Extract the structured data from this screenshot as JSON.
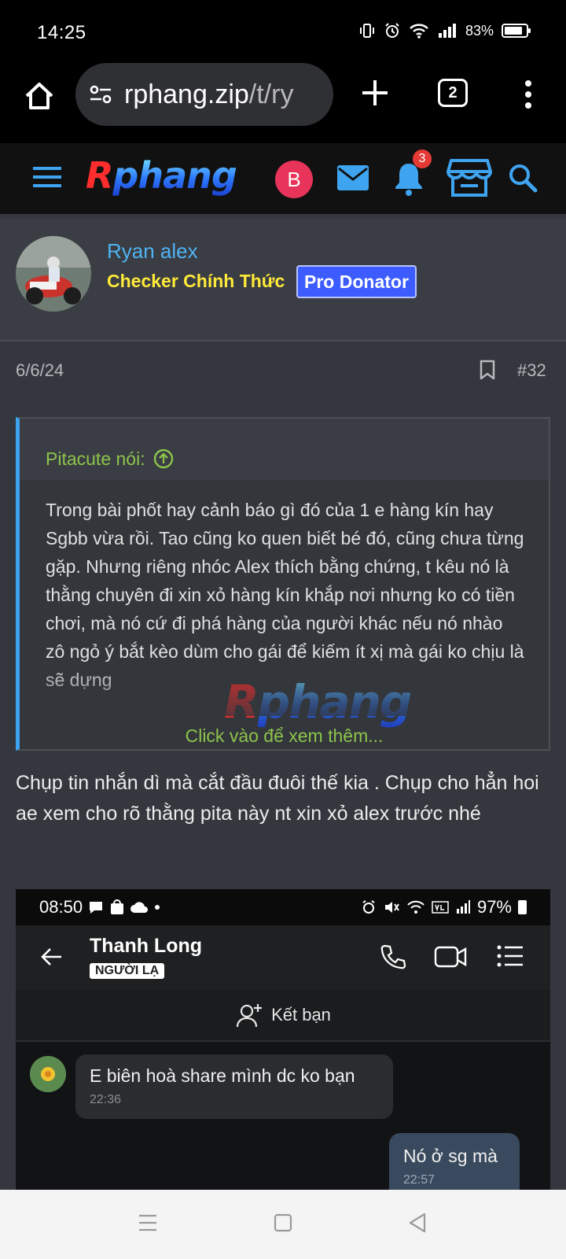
{
  "status_bar": {
    "time": "14:25",
    "battery": "83%"
  },
  "browser": {
    "url_host": "rphang.zip",
    "url_path": "/t/ry",
    "tab_count": "2"
  },
  "site_header": {
    "logo_r": "R",
    "logo_rest": "phang",
    "avatar_letter": "B",
    "notification_count": "3"
  },
  "post": {
    "author": "Ryan alex",
    "author_title": "Checker Chính Thức",
    "badge": "Pro Donator",
    "date": "6/6/24",
    "number": "#32",
    "quote": {
      "author_line": "Pitacute nói:",
      "text": "Trong bài phốt hay cảnh báo gì đó của 1 e hàng kín hay Sgbb vừa rồi. Tao cũng ko quen biết bé đó, cũng chưa từng gặp. Nhưng riêng nhóc Alex thích bằng chứng, t kêu nó là thằng chuyên đi xin xỏ hàng kín khắp nơi nhưng ko có tiền chơi, mà nó cứ đi phá hàng của người khác nếu nó nhào zô ngỏ ý bắt kèo dùm cho gái để kiếm ít xị mà gái ko chịu là sẽ dựng",
      "expand_link": "Click vào để xem thêm..."
    },
    "body": "Chụp tin nhắn dì mà cắt đầu đuôi thế kia . Chụp cho hẳn hoi ae xem cho rõ thằng pita này nt xin xỏ alex trước nhé"
  },
  "embedded_screenshot": {
    "time": "08:50",
    "battery": "97%",
    "contact_name": "Thanh Long",
    "contact_tag": "NGƯỜI LẠ",
    "add_friend": "Kết bạn",
    "messages": [
      {
        "text": "E biên hoà share mình dc ko bạn",
        "time": "22:36"
      },
      {
        "text": "Nó ở sg mà",
        "time": "22:57"
      }
    ]
  }
}
